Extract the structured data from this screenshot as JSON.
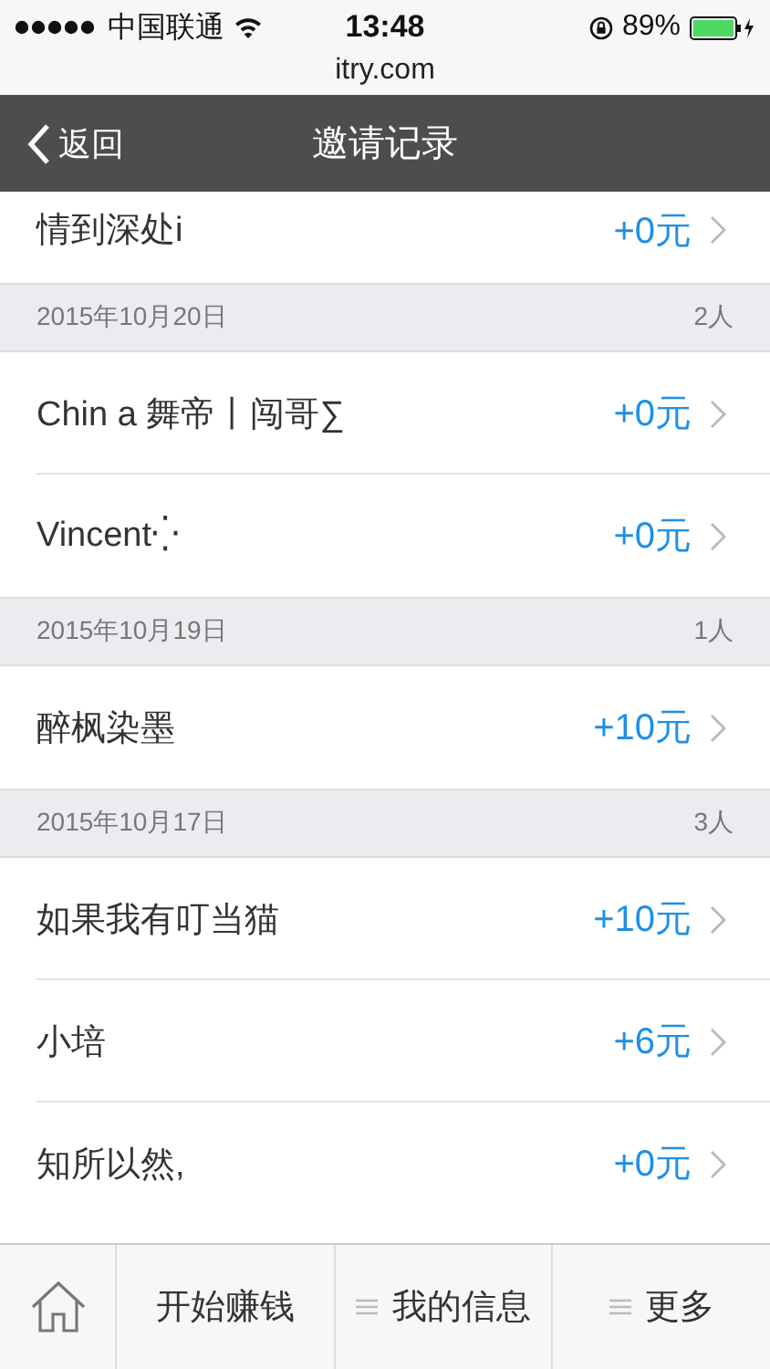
{
  "status_bar": {
    "carrier": "中国联通",
    "time": "13:48",
    "battery": "89%"
  },
  "url": "itry.com",
  "nav": {
    "back": "返回",
    "title": "邀请记录"
  },
  "groups": [
    {
      "rows": [
        {
          "name": "情到深处i",
          "reward": "+0元"
        }
      ]
    },
    {
      "date": "2015年10月20日",
      "count": "2人",
      "rows": [
        {
          "name": "Chin a 舞帝丨闯哥∑",
          "reward": "+0元"
        },
        {
          "name": "Vincent⁛",
          "reward": "+0元"
        }
      ]
    },
    {
      "date": "2015年10月19日",
      "count": "1人",
      "rows": [
        {
          "name": "醉枫染墨",
          "reward": "+10元"
        }
      ]
    },
    {
      "date": "2015年10月17日",
      "count": "3人",
      "rows": [
        {
          "name": "如果我有叮当猫",
          "reward": "+10元"
        },
        {
          "name": "小培",
          "reward": "+6元"
        },
        {
          "name": "知所以然,",
          "reward": "+0元"
        }
      ]
    }
  ],
  "tab_bar": [
    {
      "kind": "home"
    },
    {
      "kind": "text",
      "label": "开始赚钱"
    },
    {
      "kind": "menu",
      "label": "我的信息"
    },
    {
      "kind": "menu",
      "label": "更多"
    }
  ]
}
